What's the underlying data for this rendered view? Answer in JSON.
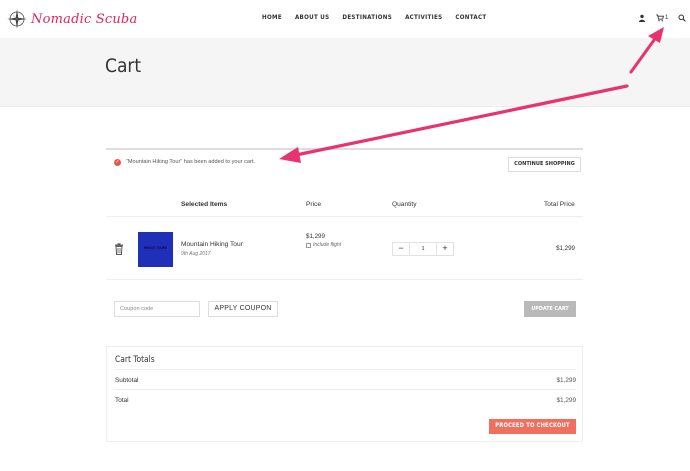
{
  "header": {
    "logo_text": "Nomadic Scuba",
    "nav": [
      "HOME",
      "ABOUT US",
      "DESTINATIONS",
      "ACTIVITIES",
      "CONTACT"
    ],
    "cart_count": "1"
  },
  "page": {
    "title": "Cart"
  },
  "notice": {
    "message": "“Mountain Hiking Tour” has been added to your cart.",
    "continue_label": "CONTINUE SHOPPING"
  },
  "table": {
    "headers": {
      "items": "Selected Items",
      "price": "Price",
      "quantity": "Quantity",
      "total": "Total Price"
    },
    "item": {
      "thumb_text": "HIKING TOURS",
      "name": "Mountain Hiking Tour",
      "date": "9th Aug 2017",
      "price": "$1,299",
      "flight_label": "Include flight",
      "qty": "1",
      "total": "$1,299"
    }
  },
  "coupon": {
    "placeholder": "Coupon code",
    "apply_label": "APPLY COUPON",
    "update_label": "UPDATE CART"
  },
  "totals": {
    "title": "Cart Totals",
    "subtotal_label": "Subtotal",
    "subtotal_value": "$1,299",
    "total_label": "Total",
    "total_value": "$1,299",
    "checkout_label": "PROCEED TO CHECKOUT"
  },
  "colors": {
    "accent": "#f07060",
    "logo": "#e0245e",
    "annotation": "#e8336e",
    "thumb": "#1f2fb8"
  }
}
